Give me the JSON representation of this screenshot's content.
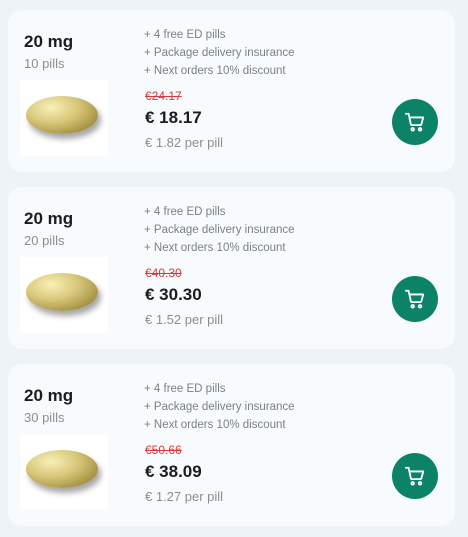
{
  "offers": [
    {
      "dose": "20 mg",
      "quantity": "10 pills",
      "perks": [
        "+ 4 free ED pills",
        "+ Package delivery insurance",
        "+ Next orders 10% discount"
      ],
      "old_price": "€24.17",
      "price": "€ 18.17",
      "per_pill": "€ 1.82 per pill"
    },
    {
      "dose": "20 mg",
      "quantity": "20 pills",
      "perks": [
        "+ 4 free ED pills",
        "+ Package delivery insurance",
        "+ Next orders 10% discount"
      ],
      "old_price": "€40.30",
      "price": "€ 30.30",
      "per_pill": "€ 1.52 per pill"
    },
    {
      "dose": "20 mg",
      "quantity": "30 pills",
      "perks": [
        "+ 4 free ED pills",
        "+ Package delivery insurance",
        "+ Next orders 10% discount"
      ],
      "old_price": "€50.66",
      "price": "€ 38.09",
      "per_pill": "€ 1.27 per pill"
    }
  ],
  "colors": {
    "accent": "#0c8368",
    "old_price": "#d83a3a",
    "card_bg": "#f8fbfd",
    "page_bg": "#eef3f7"
  },
  "icons": {
    "cart": "shopping-cart-icon"
  }
}
